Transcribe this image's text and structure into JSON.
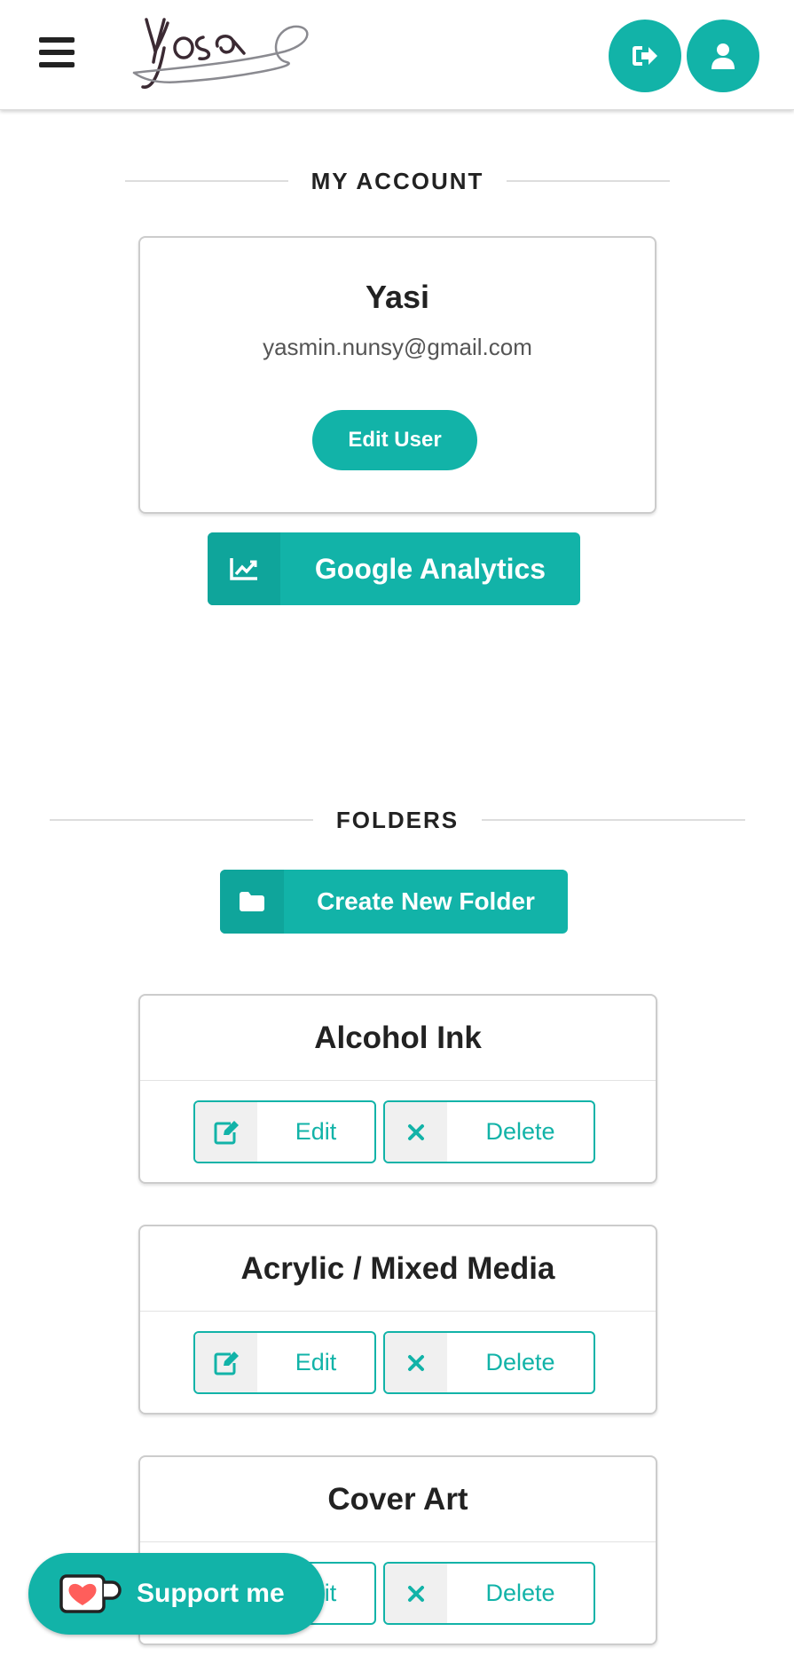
{
  "header": {
    "menu_icon": "hamburger-icon",
    "logo_text": "Yosa",
    "logout_icon": "sign-out-icon",
    "user_icon": "user-icon",
    "accent": "#12b3a8"
  },
  "account": {
    "section_title": "MY ACCOUNT",
    "name": "Yasi",
    "email": "yasmin.nunsy@gmail.com",
    "edit_user_label": "Edit User",
    "analytics_label": "Google Analytics",
    "analytics_icon": "chart-line-icon"
  },
  "folders": {
    "section_title": "FOLDERS",
    "create_label": "Create New Folder",
    "create_icon": "folder-icon",
    "items": [
      {
        "title": "Alcohol Ink",
        "edit_label": "Edit",
        "delete_label": "Delete"
      },
      {
        "title": "Acrylic / Mixed Media",
        "edit_label": "Edit",
        "delete_label": "Delete"
      },
      {
        "title": "Cover Art",
        "edit_label": "Edit",
        "delete_label": "Delete"
      }
    ]
  },
  "support": {
    "label": "Support me",
    "icon": "ko-fi-cup-icon"
  }
}
